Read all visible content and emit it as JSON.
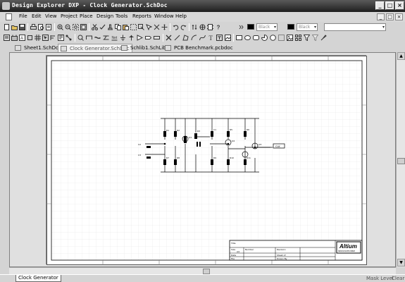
{
  "window": {
    "title": "Design Explorer DXP - Clock Generator.SchDoc",
    "controls": [
      "_",
      "□",
      "×"
    ]
  },
  "menu": {
    "items": [
      "File",
      "Edit",
      "View",
      "Project",
      "Place",
      "Design",
      "Tools",
      "Reports",
      "Window",
      "Help"
    ],
    "mdi_controls": [
      "_",
      "□",
      "×"
    ]
  },
  "toolbar": {
    "color1_label": "Black",
    "color2_label": "Black"
  },
  "tabs": [
    {
      "label": "Sheet1.SchDoc",
      "active": false
    },
    {
      "label": "Clock Generator.SchDoc",
      "active": true
    },
    {
      "label": "Schlib1.SchLib",
      "active": false
    },
    {
      "label": "PCB Benchmark.pcbdoc",
      "active": false
    }
  ],
  "schematic": {
    "output_label": "CLK",
    "logo_text": "Altium",
    "logo_subtext": "DESIGN EXPLORER",
    "title_block": {
      "title_label": "Title",
      "size_label": "Size",
      "size_value": "A4",
      "number_label": "Number",
      "revision_label": "Revision",
      "date_label": "Date",
      "file_label": "File",
      "sheet_label": "Sheet of",
      "drawn_label": "Drawn By"
    }
  },
  "status": {
    "sheet_tab": "Clock Generator",
    "mask_level": "Mask Level",
    "clear": "Clear"
  }
}
